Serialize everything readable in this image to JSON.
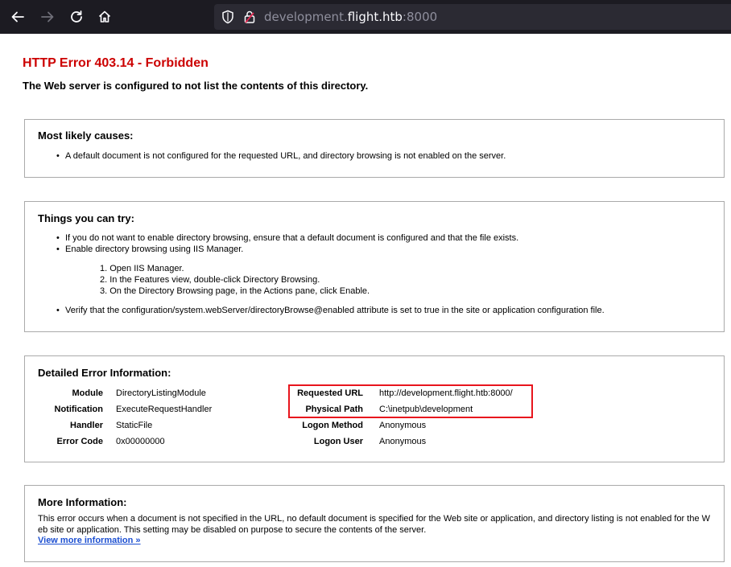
{
  "browser": {
    "url_prefix": "development.",
    "url_domain": "flight.htb",
    "url_port": ":8000",
    "icons": [
      "back-arrow-icon",
      "forward-arrow-icon",
      "reload-icon",
      "home-icon",
      "shield-icon",
      "lock-icon"
    ]
  },
  "page": {
    "title": "HTTP Error 403.14 - Forbidden",
    "subtitle": "The Web server is configured to not list the contents of this directory.",
    "title_color": "#cc0000"
  },
  "causes": {
    "heading": "Most likely causes:",
    "items": [
      "A default document is not configured for the requested URL, and directory browsing is not enabled on the server."
    ]
  },
  "try": {
    "heading": "Things you can try:",
    "items": [
      "If you do not want to enable directory browsing, ensure that a default document is configured and that the file exists.",
      "Enable directory browsing using IIS Manager."
    ],
    "steps": [
      "1. Open IIS Manager.",
      "2. In the Features view, double-click Directory Browsing.",
      "3. On the Directory Browsing page, in the Actions pane, click Enable."
    ],
    "last_item": "Verify that the configuration/system.webServer/directoryBrowse@enabled attribute is set to true in the site or application configuration file."
  },
  "details": {
    "heading": "Detailed Error Information:",
    "left": [
      {
        "label": "Module",
        "value": "DirectoryListingModule"
      },
      {
        "label": "Notification",
        "value": "ExecuteRequestHandler"
      },
      {
        "label": "Handler",
        "value": "StaticFile"
      },
      {
        "label": "Error Code",
        "value": "0x00000000"
      }
    ],
    "right": [
      {
        "label": "Requested URL",
        "value": "http://development.flight.htb:8000/"
      },
      {
        "label": "Physical Path",
        "value": "C:\\inetpub\\development"
      },
      {
        "label": "Logon Method",
        "value": "Anonymous"
      },
      {
        "label": "Logon User",
        "value": "Anonymous"
      }
    ],
    "highlight_color": "#e8151d"
  },
  "more": {
    "heading": "More Information:",
    "text": "This error occurs when a document is not specified in the URL, no default document is specified for the Web site or application, and directory listing is not enabled for the Web site or application. This setting may be disabled on purpose to secure the contents of the server.",
    "link": "View more information »"
  }
}
